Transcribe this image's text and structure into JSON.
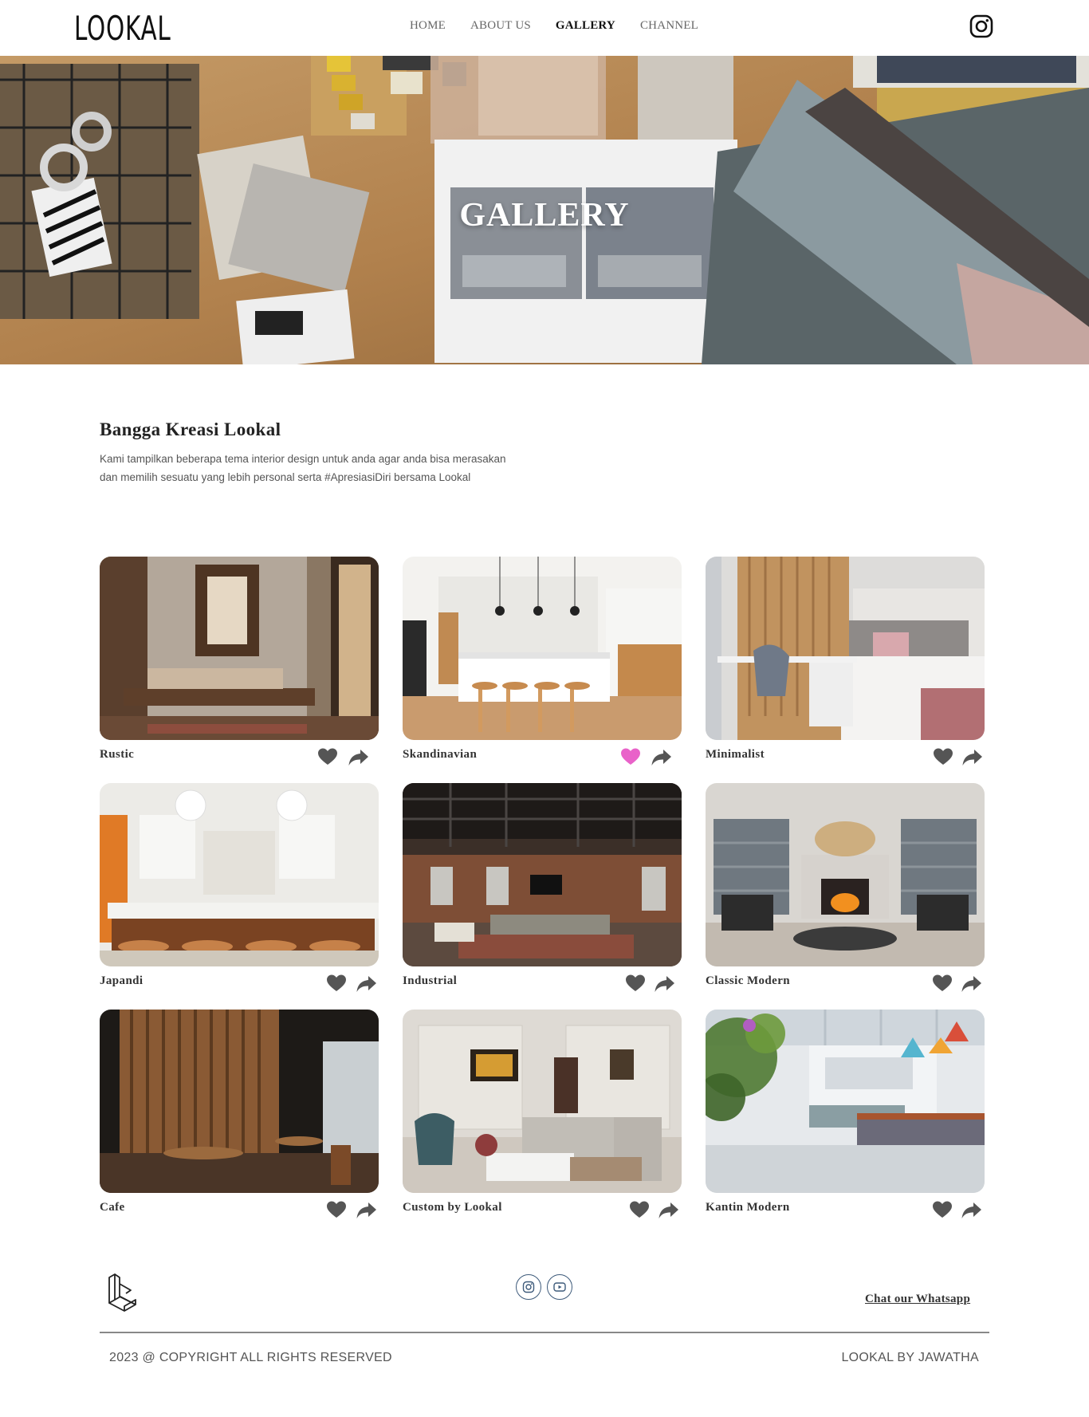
{
  "nav": {
    "logo": "LOOKAL",
    "items": [
      {
        "label": "HOME",
        "active": false
      },
      {
        "label": "ABOUT US",
        "active": false
      },
      {
        "label": "GALLERY",
        "active": true
      },
      {
        "label": "CHANNEL",
        "active": false
      }
    ]
  },
  "hero": {
    "title": "GALLERY"
  },
  "intro": {
    "title": "Bangga Kreasi Lookal",
    "text": "Kami tampilkan beberapa tema interior design untuk anda agar anda bisa merasakan dan memilih sesuatu yang lebih personal serta #ApresiasiDiri bersama Lookal"
  },
  "gallery": [
    {
      "name": "Rustic",
      "liked": false
    },
    {
      "name": "Skandinavian",
      "liked": true
    },
    {
      "name": "Minimalist",
      "liked": false
    },
    {
      "name": "Japandi",
      "liked": false
    },
    {
      "name": "Industrial",
      "liked": false
    },
    {
      "name": "Classic Modern",
      "liked": false
    },
    {
      "name": "Cafe",
      "liked": false
    },
    {
      "name": "Custom by Lookal",
      "liked": false
    },
    {
      "name": "Kantin Modern",
      "liked": false
    }
  ],
  "colors": {
    "heart": "#555555",
    "heart_liked": "#e962c9",
    "share": "#555555"
  },
  "footer": {
    "whatsapp": "Chat our Whatsapp",
    "copyright": "2023 @ COPYRIGHT ALL RIGHTS RESERVED",
    "credit": "LOOKAL BY JAWATHA"
  }
}
